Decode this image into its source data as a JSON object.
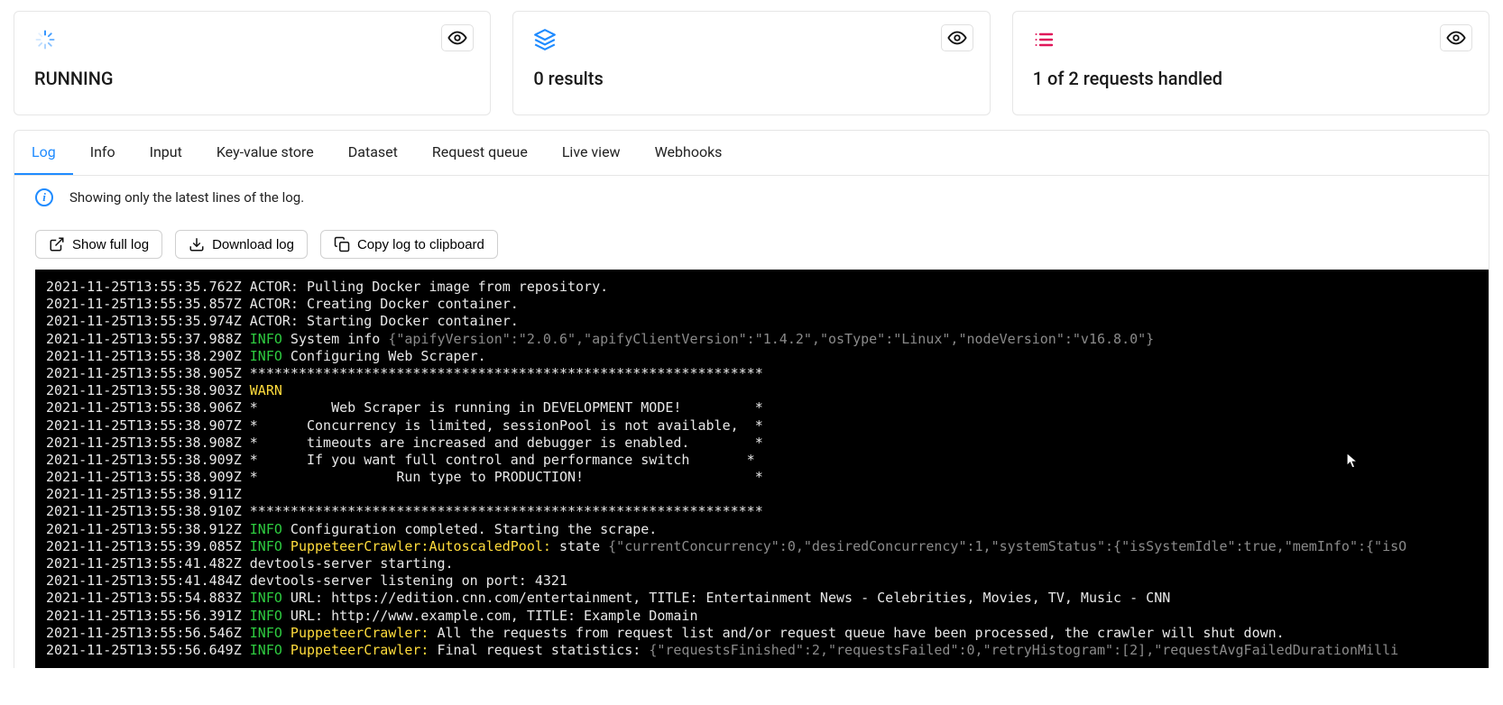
{
  "cards": {
    "status": {
      "text": "RUNNING"
    },
    "results": {
      "text": "0 results"
    },
    "requests": {
      "text": "1 of 2 requests handled"
    }
  },
  "tabs": [
    {
      "id": "log",
      "label": "Log",
      "active": true
    },
    {
      "id": "info",
      "label": "Info"
    },
    {
      "id": "input",
      "label": "Input"
    },
    {
      "id": "kvs",
      "label": "Key-value store"
    },
    {
      "id": "dataset",
      "label": "Dataset"
    },
    {
      "id": "rq",
      "label": "Request queue"
    },
    {
      "id": "lv",
      "label": "Live view"
    },
    {
      "id": "wh",
      "label": "Webhooks"
    }
  ],
  "info_banner": "Showing only the latest lines of the log.",
  "buttons": {
    "show_full": "Show full log",
    "download": "Download log",
    "copy": "Copy log to clipboard"
  },
  "colors": {
    "accent": "#1f8bff",
    "running_icon": "#1f8bff",
    "results_icon": "#1f8bff",
    "requests_icon": "#e0175a",
    "log_info": "#2ecc40",
    "log_warn": "#ffdc3c",
    "log_tag": "#ffdc3c",
    "log_json": "#8a8a8a"
  },
  "log_lines": [
    {
      "ts": "2021-11-25T13:55:35.762Z",
      "level": "",
      "tag": "",
      "msg": "ACTOR: Pulling Docker image from repository.",
      "json": ""
    },
    {
      "ts": "2021-11-25T13:55:35.857Z",
      "level": "",
      "tag": "",
      "msg": "ACTOR: Creating Docker container.",
      "json": ""
    },
    {
      "ts": "2021-11-25T13:55:35.974Z",
      "level": "",
      "tag": "",
      "msg": "ACTOR: Starting Docker container.",
      "json": ""
    },
    {
      "ts": "2021-11-25T13:55:37.988Z",
      "level": "INFO",
      "tag": "",
      "msg": " System info ",
      "json": "{\"apifyVersion\":\"2.0.6\",\"apifyClientVersion\":\"1.4.2\",\"osType\":\"Linux\",\"nodeVersion\":\"v16.8.0\"}"
    },
    {
      "ts": "2021-11-25T13:55:38.290Z",
      "level": "INFO",
      "tag": "",
      "msg": " Configuring Web Scraper.",
      "json": ""
    },
    {
      "ts": "2021-11-25T13:55:38.905Z",
      "level": "",
      "tag": "",
      "msg": "***************************************************************",
      "json": ""
    },
    {
      "ts": "2021-11-25T13:55:38.903Z",
      "level": "WARN",
      "tag": "",
      "msg": "",
      "json": ""
    },
    {
      "ts": "2021-11-25T13:55:38.906Z",
      "level": "",
      "tag": "",
      "msg": "*         Web Scraper is running in DEVELOPMENT MODE!         *",
      "json": ""
    },
    {
      "ts": "2021-11-25T13:55:38.907Z",
      "level": "",
      "tag": "",
      "msg": "*      Concurrency is limited, sessionPool is not available,  *",
      "json": ""
    },
    {
      "ts": "2021-11-25T13:55:38.908Z",
      "level": "",
      "tag": "",
      "msg": "*      timeouts are increased and debugger is enabled.        *",
      "json": ""
    },
    {
      "ts": "2021-11-25T13:55:38.909Z",
      "level": "",
      "tag": "",
      "msg": "*      If you want full control and performance switch       *",
      "json": ""
    },
    {
      "ts": "2021-11-25T13:55:38.909Z",
      "level": "",
      "tag": "",
      "msg": "*                 Run type to PRODUCTION!                     *",
      "json": ""
    },
    {
      "ts": "2021-11-25T13:55:38.911Z",
      "level": "",
      "tag": "",
      "msg": "",
      "json": ""
    },
    {
      "ts": "2021-11-25T13:55:38.910Z",
      "level": "",
      "tag": "",
      "msg": "***************************************************************",
      "json": ""
    },
    {
      "ts": "2021-11-25T13:55:38.912Z",
      "level": "INFO",
      "tag": "",
      "msg": " Configuration completed. Starting the scrape.",
      "json": ""
    },
    {
      "ts": "2021-11-25T13:55:39.085Z",
      "level": "INFO",
      "tag": " PuppeteerCrawler:AutoscaledPool:",
      "msg": " state ",
      "json": "{\"currentConcurrency\":0,\"desiredConcurrency\":1,\"systemStatus\":{\"isSystemIdle\":true,\"memInfo\":{\"isO"
    },
    {
      "ts": "2021-11-25T13:55:41.482Z",
      "level": "",
      "tag": "",
      "msg": "devtools-server starting.",
      "json": ""
    },
    {
      "ts": "2021-11-25T13:55:41.484Z",
      "level": "",
      "tag": "",
      "msg": "devtools-server listening on port: 4321",
      "json": ""
    },
    {
      "ts": "2021-11-25T13:55:54.883Z",
      "level": "INFO",
      "tag": "",
      "msg": " URL: https://edition.cnn.com/entertainment, TITLE: Entertainment News - Celebrities, Movies, TV, Music - CNN",
      "json": ""
    },
    {
      "ts": "2021-11-25T13:55:56.391Z",
      "level": "INFO",
      "tag": "",
      "msg": " URL: http://www.example.com, TITLE: Example Domain",
      "json": ""
    },
    {
      "ts": "2021-11-25T13:55:56.546Z",
      "level": "INFO",
      "tag": " PuppeteerCrawler:",
      "msg": " All the requests from request list and/or request queue have been processed, the crawler will shut down.",
      "json": ""
    },
    {
      "ts": "2021-11-25T13:55:56.649Z",
      "level": "INFO",
      "tag": " PuppeteerCrawler:",
      "msg": " Final request statistics: ",
      "json": "{\"requestsFinished\":2,\"requestsFailed\":0,\"retryHistogram\":[2],\"requestAvgFailedDurationMilli"
    }
  ]
}
